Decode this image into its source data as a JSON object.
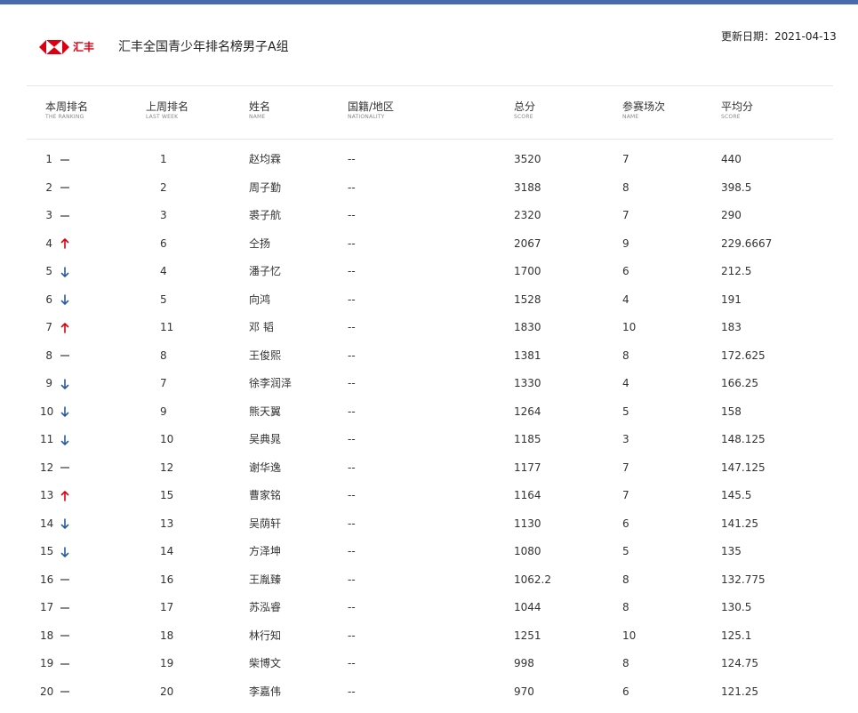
{
  "colors": {
    "top_bar": "#4a6aae",
    "up": "#db0011",
    "down": "#2a5aa3",
    "same": "#555555",
    "logo_red": "#db0011"
  },
  "header": {
    "logo_text": "汇丰",
    "title": "汇丰全国青少年排名榜男子A组",
    "update_label": "更新日期：",
    "update_date": "2021-04-13"
  },
  "table": {
    "columns": [
      {
        "cn": "本周排名",
        "en": "THE RANKING"
      },
      {
        "cn": "上周排名",
        "en": "LAST WEEK"
      },
      {
        "cn": "姓名",
        "en": "NAME"
      },
      {
        "cn": "国籍/地区",
        "en": "NATIONALITY"
      },
      {
        "cn": "总分",
        "en": "SCORE"
      },
      {
        "cn": "参赛场次",
        "en": "NAME"
      },
      {
        "cn": "平均分",
        "en": "SCORE"
      }
    ],
    "rows": [
      {
        "rank": "1",
        "trend": "same",
        "last": "1",
        "name": "赵均霖",
        "nat": "--",
        "total": "3520",
        "events": "7",
        "avg": "440"
      },
      {
        "rank": "2",
        "trend": "same",
        "last": "2",
        "name": "周子勤",
        "nat": "--",
        "total": "3188",
        "events": "8",
        "avg": "398.5"
      },
      {
        "rank": "3",
        "trend": "same",
        "last": "3",
        "name": "裘子航",
        "nat": "--",
        "total": "2320",
        "events": "7",
        "avg": "290"
      },
      {
        "rank": "4",
        "trend": "up",
        "last": "6",
        "name": "仝扬",
        "nat": "--",
        "total": "2067",
        "events": "9",
        "avg": "229.6667"
      },
      {
        "rank": "5",
        "trend": "down",
        "last": "4",
        "name": "潘子忆",
        "nat": "--",
        "total": "1700",
        "events": "6",
        "avg": "212.5"
      },
      {
        "rank": "6",
        "trend": "down",
        "last": "5",
        "name": "向鸿",
        "nat": "--",
        "total": "1528",
        "events": "4",
        "avg": "191"
      },
      {
        "rank": "7",
        "trend": "up",
        "last": "11",
        "name": "邓 韬",
        "nat": "--",
        "total": "1830",
        "events": "10",
        "avg": "183"
      },
      {
        "rank": "8",
        "trend": "same",
        "last": "8",
        "name": "王俊熙",
        "nat": "--",
        "total": "1381",
        "events": "8",
        "avg": "172.625"
      },
      {
        "rank": "9",
        "trend": "down",
        "last": "7",
        "name": "徐李润泽",
        "nat": "--",
        "total": "1330",
        "events": "4",
        "avg": "166.25"
      },
      {
        "rank": "10",
        "trend": "down",
        "last": "9",
        "name": "熊天翼",
        "nat": "--",
        "total": "1264",
        "events": "5",
        "avg": "158"
      },
      {
        "rank": "11",
        "trend": "down",
        "last": "10",
        "name": "吴典晁",
        "nat": "--",
        "total": "1185",
        "events": "3",
        "avg": "148.125"
      },
      {
        "rank": "12",
        "trend": "same",
        "last": "12",
        "name": "谢华逸",
        "nat": "--",
        "total": "1177",
        "events": "7",
        "avg": "147.125"
      },
      {
        "rank": "13",
        "trend": "up",
        "last": "15",
        "name": "曹家铭",
        "nat": "--",
        "total": "1164",
        "events": "7",
        "avg": "145.5"
      },
      {
        "rank": "14",
        "trend": "down",
        "last": "13",
        "name": "吴荫轩",
        "nat": "--",
        "total": "1130",
        "events": "6",
        "avg": "141.25"
      },
      {
        "rank": "15",
        "trend": "down",
        "last": "14",
        "name": "方泽坤",
        "nat": "--",
        "total": "1080",
        "events": "5",
        "avg": "135"
      },
      {
        "rank": "16",
        "trend": "same",
        "last": "16",
        "name": "王胤臻",
        "nat": "--",
        "total": "1062.2",
        "events": "8",
        "avg": "132.775"
      },
      {
        "rank": "17",
        "trend": "same",
        "last": "17",
        "name": "苏泓睿",
        "nat": "--",
        "total": "1044",
        "events": "8",
        "avg": "130.5"
      },
      {
        "rank": "18",
        "trend": "same",
        "last": "18",
        "name": "林行知",
        "nat": "--",
        "total": "1251",
        "events": "10",
        "avg": "125.1"
      },
      {
        "rank": "19",
        "trend": "same",
        "last": "19",
        "name": "柴博文",
        "nat": "--",
        "total": "998",
        "events": "8",
        "avg": "124.75"
      },
      {
        "rank": "20",
        "trend": "same",
        "last": "20",
        "name": "李嘉伟",
        "nat": "--",
        "total": "970",
        "events": "6",
        "avg": "121.25"
      }
    ]
  }
}
